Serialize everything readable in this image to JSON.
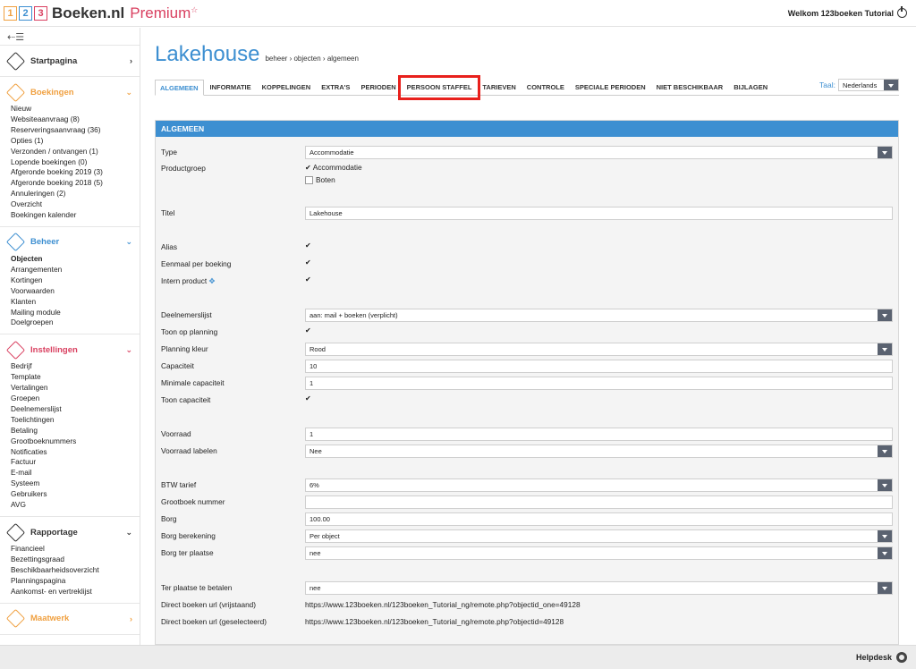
{
  "logo": {
    "n1": "1",
    "n2": "2",
    "n3": "3",
    "brand": "Boeken.nl",
    "premium": "Premium",
    "star": "☆"
  },
  "header": {
    "welcome": "Welkom 123boeken Tutorial"
  },
  "sidebar": {
    "toggle": "⇠☰",
    "sections": [
      {
        "title": "Startpagina",
        "color": "#333333",
        "chev": "›",
        "items": []
      },
      {
        "title": "Boekingen",
        "color": "#f0a040",
        "chev": "⌄",
        "items": [
          "Nieuw",
          "Websiteaanvraag (8)",
          "Reserveringsaanvraag (36)",
          "Opties (1)",
          "Verzonden / ontvangen (1)",
          "Lopende boekingen (0)",
          "Afgeronde boeking 2019 (3)",
          "Afgeronde boeking 2018 (5)",
          "Annuleringen (2)",
          "Overzicht",
          "Boekingen kalender"
        ]
      },
      {
        "title": "Beheer",
        "color": "#3d8fd1",
        "chev": "⌄",
        "items": [
          "Objecten",
          "Arrangementen",
          "Kortingen",
          "Voorwaarden",
          "Klanten",
          "Mailing module",
          "Doelgroepen"
        ]
      },
      {
        "title": "Instellingen",
        "color": "#d94060",
        "chev": "⌄",
        "items": [
          "Bedrijf",
          "Template",
          "Vertalingen",
          "Groepen",
          "Deelnemerslijst",
          "Toelichtingen",
          "Betaling",
          "Grootboeknummers",
          "Notificaties",
          "Factuur",
          "E-mail",
          "Systeem",
          "Gebruikers",
          "AVG"
        ]
      },
      {
        "title": "Rapportage",
        "color": "#333333",
        "chev": "⌄",
        "items": [
          "Financieel",
          "Bezettingsgraad",
          "Beschikbaarheidsoverzicht",
          "Planningspagina",
          "Aankomst- en vertreklijst"
        ]
      },
      {
        "title": "Maatwerk",
        "color": "#f0a040",
        "chev": "›",
        "items": []
      }
    ]
  },
  "page": {
    "title": "Lakehouse",
    "breadcrumb": "beheer › objecten › algemeen"
  },
  "tabs": [
    "ALGEMEEN",
    "INFORMATIE",
    "KOPPELINGEN",
    "EXTRA'S",
    "PERIODEN",
    "PERSOON STAFFEL",
    "TARIEVEN",
    "CONTROLE",
    "SPECIALE PERIODEN",
    "NIET BESCHIKBAAR",
    "BIJLAGEN"
  ],
  "taal": {
    "label": "Taal:",
    "value": "Nederlands"
  },
  "panel": {
    "title": "ALGEMEEN"
  },
  "form": {
    "type": {
      "label": "Type",
      "value": "Accommodatie"
    },
    "productgroep": {
      "label": "Productgroep",
      "opt1": "Accommodatie",
      "opt2": "Boten"
    },
    "titel": {
      "label": "Titel",
      "value": "Lakehouse"
    },
    "alias": {
      "label": "Alias"
    },
    "eenmaal": {
      "label": "Eenmaal per boeking"
    },
    "intern": {
      "label": "Intern product"
    },
    "deelnemerslijst": {
      "label": "Deelnemerslijst",
      "value": "aan: mail + boeken (verplicht)"
    },
    "toon_planning": {
      "label": "Toon op planning"
    },
    "planning_kleur": {
      "label": "Planning kleur",
      "value": "Rood"
    },
    "capaciteit": {
      "label": "Capaciteit",
      "value": "10"
    },
    "min_capaciteit": {
      "label": "Minimale capaciteit",
      "value": "1"
    },
    "toon_capaciteit": {
      "label": "Toon capaciteit"
    },
    "voorraad": {
      "label": "Voorraad",
      "value": "1"
    },
    "voorraad_labelen": {
      "label": "Voorraad labelen",
      "value": "Nee"
    },
    "btw": {
      "label": "BTW tarief",
      "value": "6%"
    },
    "grootboek": {
      "label": "Grootboek nummer",
      "value": ""
    },
    "borg": {
      "label": "Borg",
      "value": "100.00"
    },
    "borg_berekening": {
      "label": "Borg berekening",
      "value": "Per object"
    },
    "borg_ter_plaatse": {
      "label": "Borg ter plaatse",
      "value": "nee"
    },
    "ter_plaatse_betalen": {
      "label": "Ter plaatse te betalen",
      "value": "nee"
    },
    "url_vrij": {
      "label": "Direct boeken url (vrijstaand)",
      "value": "https://www.123boeken.nl/123boeken_Tutorial_ng/remote.php?objectid_one=49128"
    },
    "url_sel": {
      "label": "Direct boeken url (geselecteerd)",
      "value": "https://www.123boeken.nl/123boeken_Tutorial_ng/remote.php?objectid=49128"
    },
    "check": "✔"
  },
  "footer": {
    "helpdesk": "Helpdesk"
  }
}
